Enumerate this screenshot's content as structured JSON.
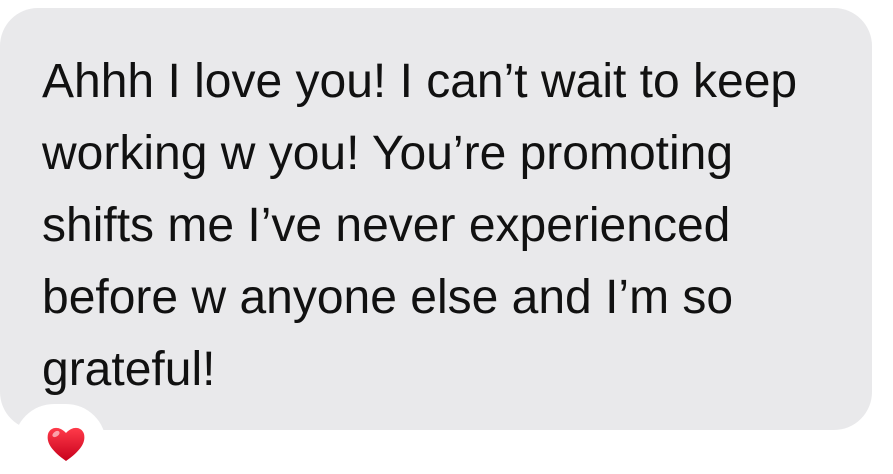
{
  "message": {
    "text": "Ahhh I love you! I can’t wait to keep working w you! You’re promoting shifts me I’ve never experienced before w anyone else and I’m so grateful!"
  },
  "reaction": {
    "icon": "heart-icon",
    "color": "#e0112b"
  },
  "colors": {
    "bubble": "#e9e9eb",
    "text": "#111111",
    "background": "#ffffff"
  }
}
